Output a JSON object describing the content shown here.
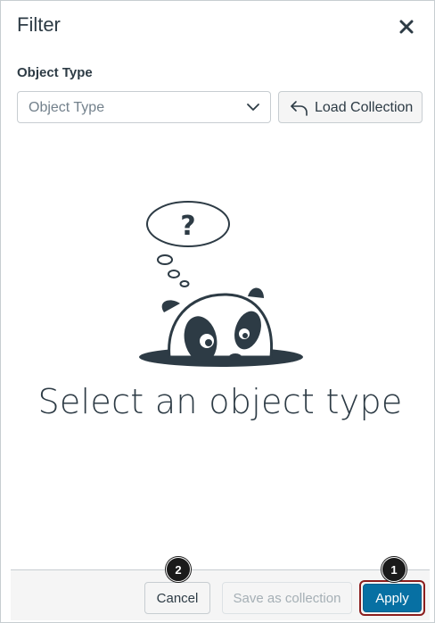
{
  "dialog": {
    "title": "Filter",
    "close_icon": "close-icon"
  },
  "object_type": {
    "label": "Object Type",
    "select_placeholder": "Object Type",
    "chevron_icon": "chevron-down-icon"
  },
  "load_collection": {
    "label": "Load Collection",
    "icon": "undo-arrow-icon"
  },
  "empty_state": {
    "illustration": "panda-peeking-from-hole",
    "bubble_text": "?",
    "message": "Select an object type"
  },
  "footer": {
    "cancel_label": "Cancel",
    "save_label": "Save as collection",
    "apply_label": "Apply"
  },
  "callouts": {
    "apply_number": "1",
    "cancel_number": "2"
  },
  "colors": {
    "apply_background": "#0770a3",
    "highlight_outline": "#8b1d1d",
    "text_primary": "#2d3b45",
    "text_muted": "#73818c"
  }
}
